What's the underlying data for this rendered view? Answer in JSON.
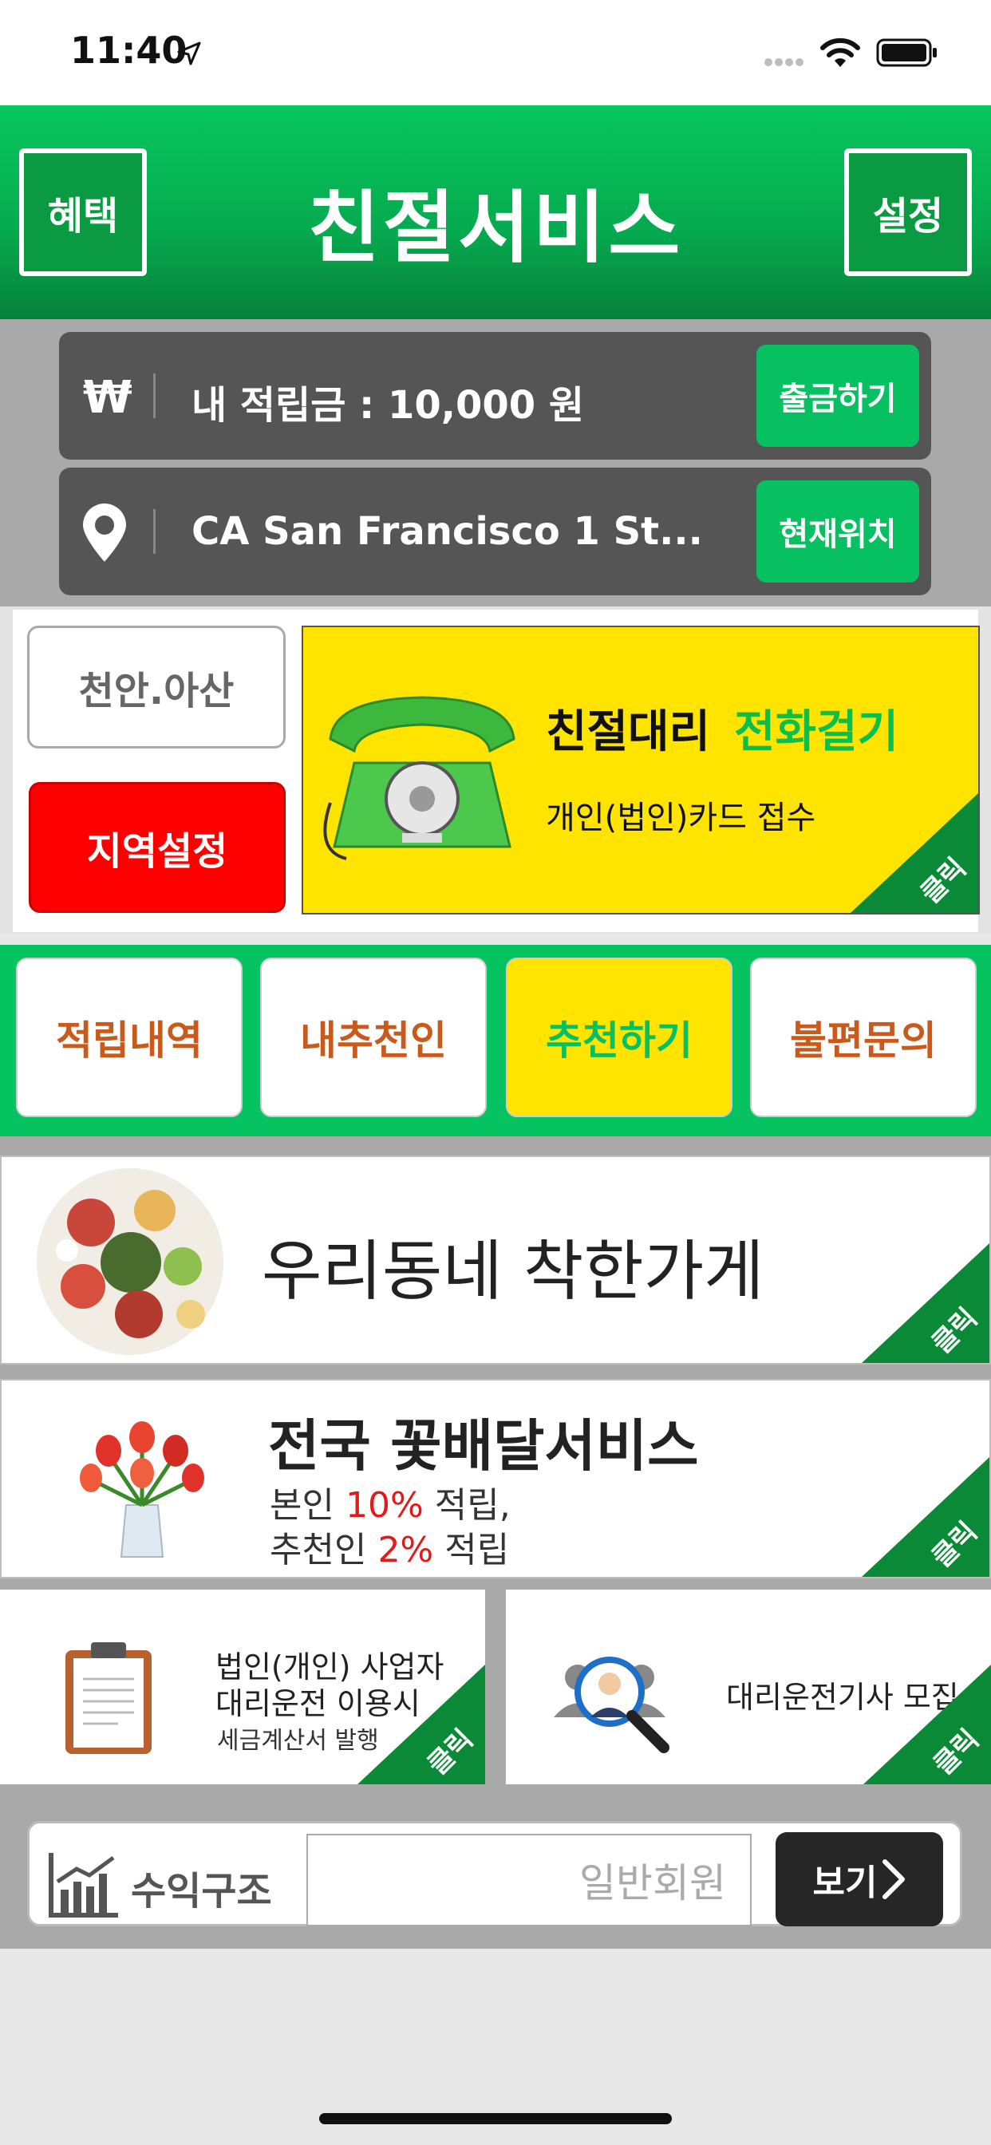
{
  "status_bar": {
    "time": "11:40"
  },
  "header": {
    "title": "친절서비스",
    "left_button": "혜택",
    "right_button": "설정"
  },
  "points": {
    "currency_symbol": "₩",
    "label": "내 적립금 :  10,000 원",
    "withdraw_button": "출금하기"
  },
  "location": {
    "address": "CA San Francisco 1 St...",
    "current_button": "현재위치"
  },
  "region": {
    "name": "천안.아산",
    "set_button": "지역설정"
  },
  "call_card": {
    "title": "친절대리",
    "action": "전화걸기",
    "subtitle": "개인(법인)카드 접수",
    "corner_label": "클릭"
  },
  "menu": [
    {
      "label": "적립내역"
    },
    {
      "label": "내추천인"
    },
    {
      "label": "추천하기"
    },
    {
      "label": "불편문의"
    }
  ],
  "banner_store": {
    "title": "우리동네 착한가게",
    "corner_label": "클릭"
  },
  "banner_flower": {
    "title": "전국 꽃배달서비스",
    "line1_prefix": "본인 ",
    "line1_highlight": "10%",
    "line1_suffix": " 적립,",
    "line2_prefix": "추천인 ",
    "line2_highlight": "2%",
    "line2_suffix": " 적립",
    "corner_label": "클릭"
  },
  "banner_tax": {
    "line1": "법인(개인) 사업자",
    "line2": "대리운전 이용시",
    "line3": "세금계산서 발행",
    "corner_label": "클릭"
  },
  "banner_recruit": {
    "text": "대리운전기사 모집",
    "corner_label": "클릭"
  },
  "profit": {
    "label": "수익구조",
    "input_value": "일반회원",
    "view_button": "보기"
  },
  "colors": {
    "brand_green": "#07c062",
    "header_green": "#06a94e",
    "alert_red": "#ff0000",
    "card_yellow": "#ffe400",
    "menu_text": "#c95a1c"
  }
}
